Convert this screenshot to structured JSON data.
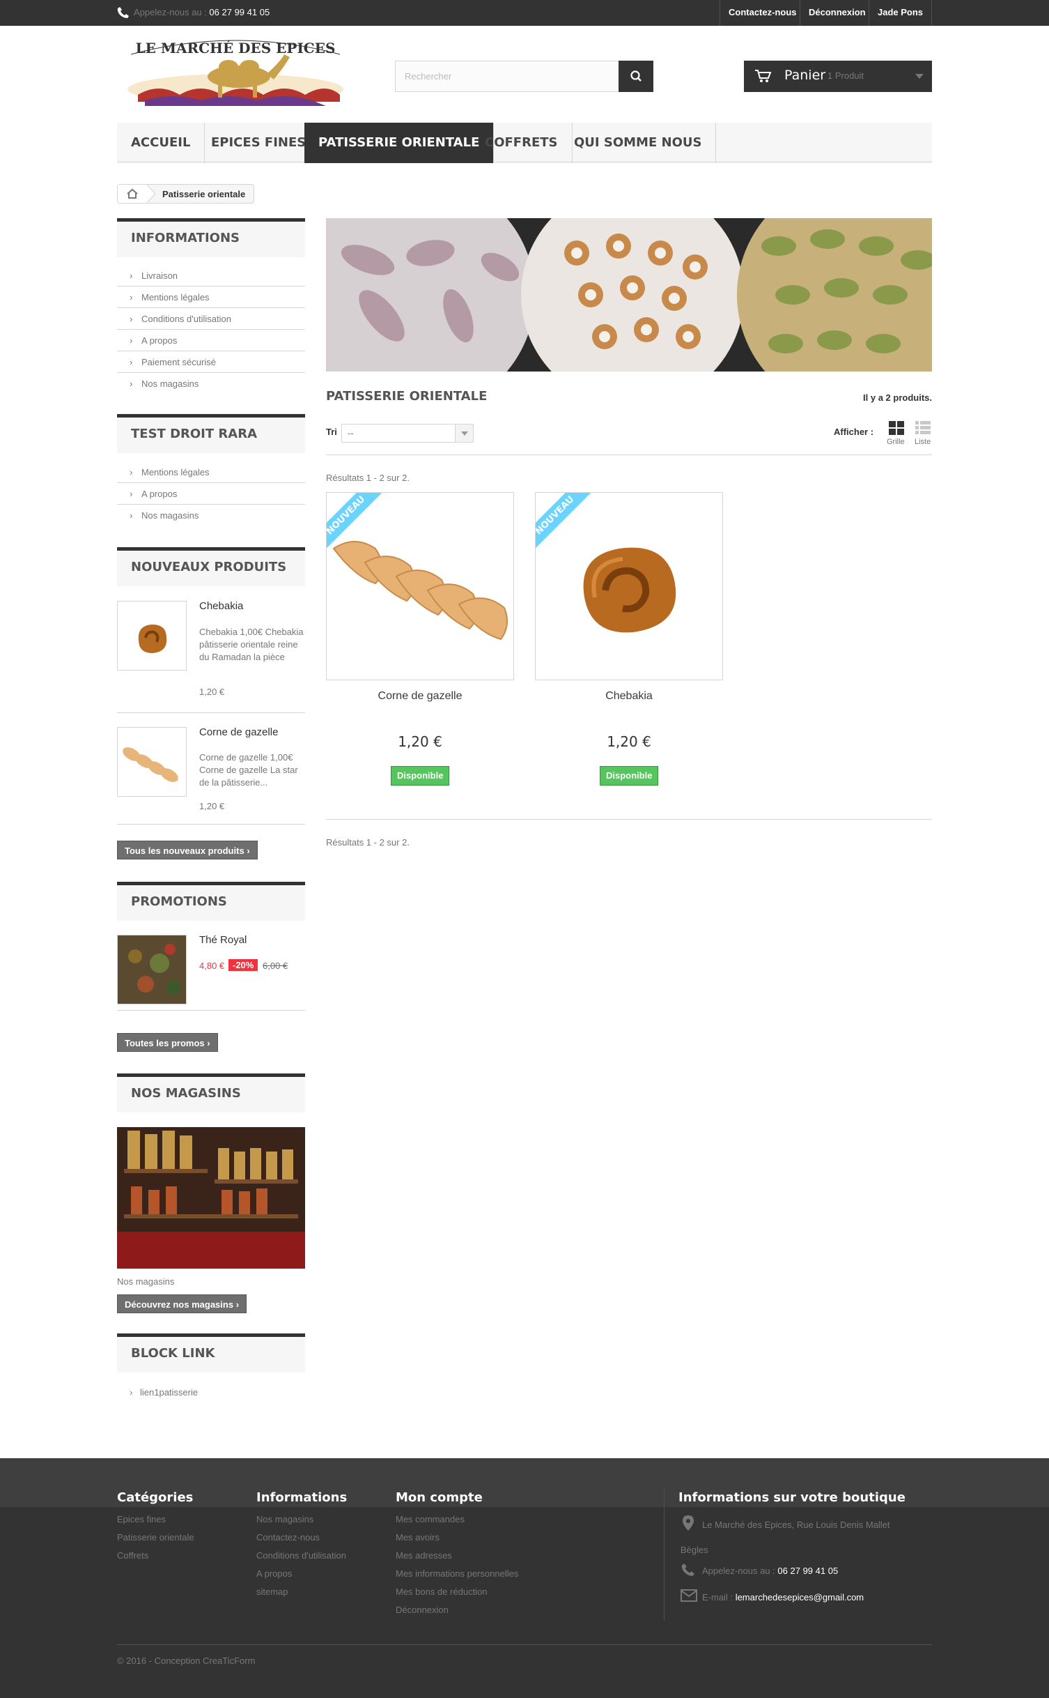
{
  "topbar": {
    "phone_label": "Appelez-nous au :",
    "phone_number": "06 27 99 41 05",
    "links": [
      "Contactez-nous",
      "Déconnexion",
      "Jade Pons"
    ]
  },
  "header": {
    "logo_text": "LE MARCHÉ DES EPICES",
    "search_placeholder": "Rechercher",
    "cart_label": "Panier",
    "cart_count": "1 Produit"
  },
  "menu": [
    {
      "label": "Accueil",
      "active": false
    },
    {
      "label": "Epices fines",
      "active": false
    },
    {
      "label": "Patisserie orientale",
      "active": true
    },
    {
      "label": "Coffrets",
      "active": false
    },
    {
      "label": "Qui somme nous",
      "active": false
    }
  ],
  "breadcrumb": {
    "current": "Patisserie orientale"
  },
  "sidebar": {
    "informations": {
      "title": "Informations",
      "items": [
        "Livraison",
        "Mentions légales",
        "Conditions d'utilisation",
        "A propos",
        "Paiement sécurisé",
        "Nos magasins"
      ]
    },
    "test_droit": {
      "title": "Test droit rara",
      "items": [
        "Mentions légales",
        "A propos",
        "Nos magasins"
      ]
    },
    "new_products": {
      "title": "Nouveaux produits",
      "products": [
        {
          "name": "Chebakia",
          "desc": "Chebakia 1,00€ Chebakia pâtisserie orientale reine du Ramadan la pièce",
          "price": "1,20 €"
        },
        {
          "name": "Corne de gazelle",
          "desc": "Corne de gazelle 1,00€ Corne de gazelle La star de la pâtisserie...",
          "price": "1,20 €"
        }
      ],
      "button": "Tous les nouveaux produits"
    },
    "promotions": {
      "title": "Promotions",
      "product": {
        "name": "Thé Royal",
        "price": "4,80 €",
        "discount": "-20%",
        "old_price": "6,00 €"
      },
      "button": "Toutes les promos"
    },
    "stores": {
      "title": "Nos magasins",
      "caption": "Nos magasins",
      "button": "Découvrez nos magasins"
    },
    "block_link": {
      "title": "Block link",
      "items": [
        "lien1patisserie"
      ]
    }
  },
  "main": {
    "category_title": "Patisserie orientale",
    "product_count": "Il y a 2 produits.",
    "sort_label": "Tri",
    "sort_value": "--",
    "display_label": "Afficher :",
    "view_grid": "Grille",
    "view_list": "Liste",
    "results_text": "Résultats 1 - 2 sur 2.",
    "products": [
      {
        "name": "Corne de gazelle",
        "price": "1,20 €",
        "availability": "Disponible",
        "badge": "Nouveau"
      },
      {
        "name": "Chebakia",
        "price": "1,20 €",
        "availability": "Disponible",
        "badge": "Nouveau"
      }
    ]
  },
  "footer": {
    "categories": {
      "title": "Catégories",
      "items": [
        "Epices fines",
        "Patisserie orientale",
        "Coffrets"
      ]
    },
    "informations": {
      "title": "Informations",
      "items": [
        "Nos magasins",
        "Contactez-nous",
        "Conditions d'utilisation",
        "A propos",
        "sitemap"
      ]
    },
    "account": {
      "title": "Mon compte",
      "items": [
        "Mes commandes",
        "Mes avoirs",
        "Mes adresses",
        "Mes informations personnelles",
        "Mes bons de réduction",
        "Déconnexion"
      ]
    },
    "store_info": {
      "title": "Informations sur votre boutique",
      "address_line1": "Le Marché des Epices, Rue Louis Denis Mallet",
      "address_line2": "Bègles",
      "phone_label": "Appelez-nous au :",
      "phone": "06 27 99 41 05",
      "email_label": "E-mail :",
      "email": "lemarchedesepices@gmail.com"
    },
    "copyright": "© 2016 - Conception CreaTicForm"
  },
  "colors": {
    "dark": "#333333",
    "ribbon": "#6ad4ff",
    "available": "#55c65e",
    "discount": "#f13340"
  }
}
